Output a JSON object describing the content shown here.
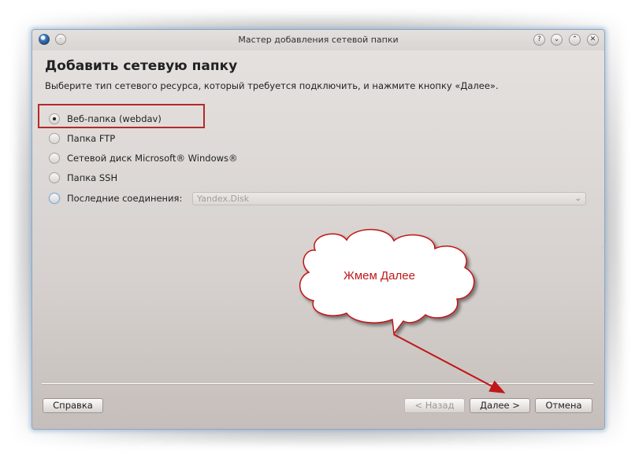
{
  "window": {
    "title": "Мастер добавления сетевой папки",
    "title_buttons": [
      "?",
      "⌄",
      "⌃",
      "✕"
    ]
  },
  "page": {
    "heading": "Добавить сетевую папку",
    "subtitle": "Выберите тип сетевого ресурса, который требуется подключить, и нажмите кнопку «Далее»."
  },
  "options": [
    {
      "label": "Веб-папка (webdav)",
      "selected": true
    },
    {
      "label": "Папка FTP",
      "selected": false
    },
    {
      "label": "Сетевой диск Microsoft® Windows®",
      "selected": false
    },
    {
      "label": "Папка SSH",
      "selected": false
    },
    {
      "label": "Последние соединения:",
      "selected": false
    }
  ],
  "recent": {
    "value": "Yandex.Disk"
  },
  "buttons": {
    "help": "Справка",
    "back": "< Назад",
    "next": "Далее >",
    "cancel": "Отмена"
  },
  "annotation": {
    "callout_text": "Жмем Далее",
    "color": "#c01818"
  }
}
